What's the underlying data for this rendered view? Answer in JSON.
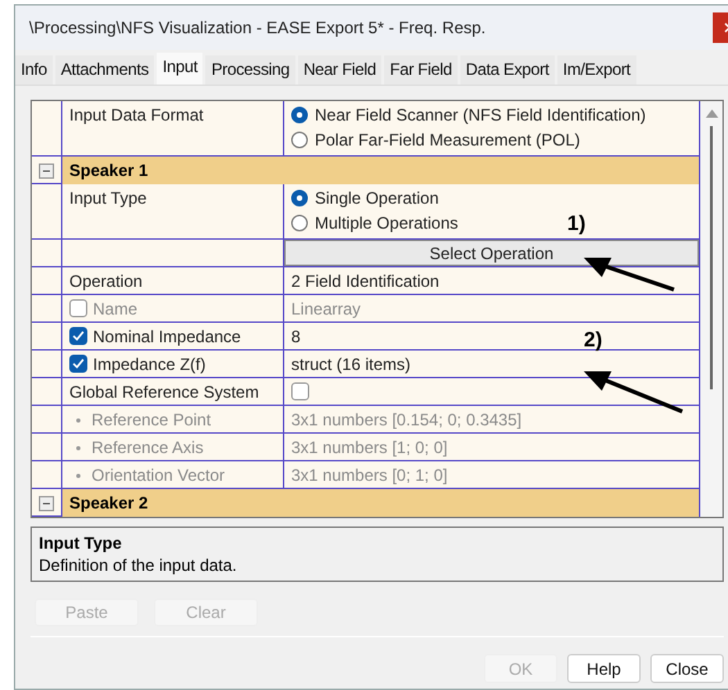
{
  "window": {
    "title": "\\Processing\\NFS Visualization - EASE Export 5* - Freq. Resp."
  },
  "tabs": [
    {
      "label": "Info",
      "selected": false
    },
    {
      "label": "Attachments",
      "selected": false
    },
    {
      "label": "Input",
      "selected": true
    },
    {
      "label": "Processing",
      "selected": false
    },
    {
      "label": "Near Field",
      "selected": false
    },
    {
      "label": "Far Field",
      "selected": false
    },
    {
      "label": "Data Export",
      "selected": false
    },
    {
      "label": "Im/Export",
      "selected": false
    }
  ],
  "grid": {
    "rows": [
      {
        "kind": "radio",
        "name": "Input Data Format",
        "options": [
          {
            "label": "Near Field Scanner (NFS Field Identification)",
            "selected": true
          },
          {
            "label": "Polar Far-Field Measurement (POL)",
            "selected": false
          }
        ]
      },
      {
        "kind": "category",
        "label": "Speaker 1",
        "expanded": true
      },
      {
        "kind": "radio",
        "name": "Input Type",
        "options": [
          {
            "label": "Single Operation",
            "selected": true
          },
          {
            "label": "Multiple Operations",
            "selected": false
          }
        ]
      },
      {
        "kind": "button",
        "label": "Select Operation"
      },
      {
        "kind": "text",
        "name": "Operation",
        "value": "2 Field Identification",
        "disabled": false
      },
      {
        "kind": "text",
        "name": "Name",
        "value": "Linearray",
        "disabled": true,
        "name_checked": false
      },
      {
        "kind": "text",
        "name": "Nominal Impedance",
        "value": "8",
        "disabled": false,
        "name_checked": true
      },
      {
        "kind": "text",
        "name": "Impedance Z(f)",
        "value": "struct (16 items)",
        "disabled": false,
        "name_checked": true
      },
      {
        "kind": "checkbox",
        "name": "Global Reference System",
        "checked": false,
        "children": [
          {
            "kind": "text",
            "name": "Reference Point",
            "value": "3x1 numbers [0.154; 0; 0.3435]",
            "disabled": true
          },
          {
            "kind": "text",
            "name": "Reference Axis",
            "value": "3x1 numbers [1; 0; 0]",
            "disabled": true
          },
          {
            "kind": "text",
            "name": "Orientation Vector",
            "value": "3x1 numbers [0; 1; 0]",
            "disabled": true
          }
        ]
      },
      {
        "kind": "category",
        "label": "Speaker 2",
        "expanded": true
      }
    ]
  },
  "annotations": [
    {
      "label": "1)"
    },
    {
      "label": "2)"
    }
  ],
  "description": {
    "title": "Input Type",
    "text": "Definition of the input data."
  },
  "edit_buttons": [
    {
      "label": "Paste",
      "disabled": true
    },
    {
      "label": "Clear",
      "disabled": true
    }
  ],
  "footer_buttons": [
    {
      "label": "OK",
      "disabled": true
    },
    {
      "label": "Help",
      "disabled": false
    },
    {
      "label": "Close",
      "disabled": false
    }
  ]
}
